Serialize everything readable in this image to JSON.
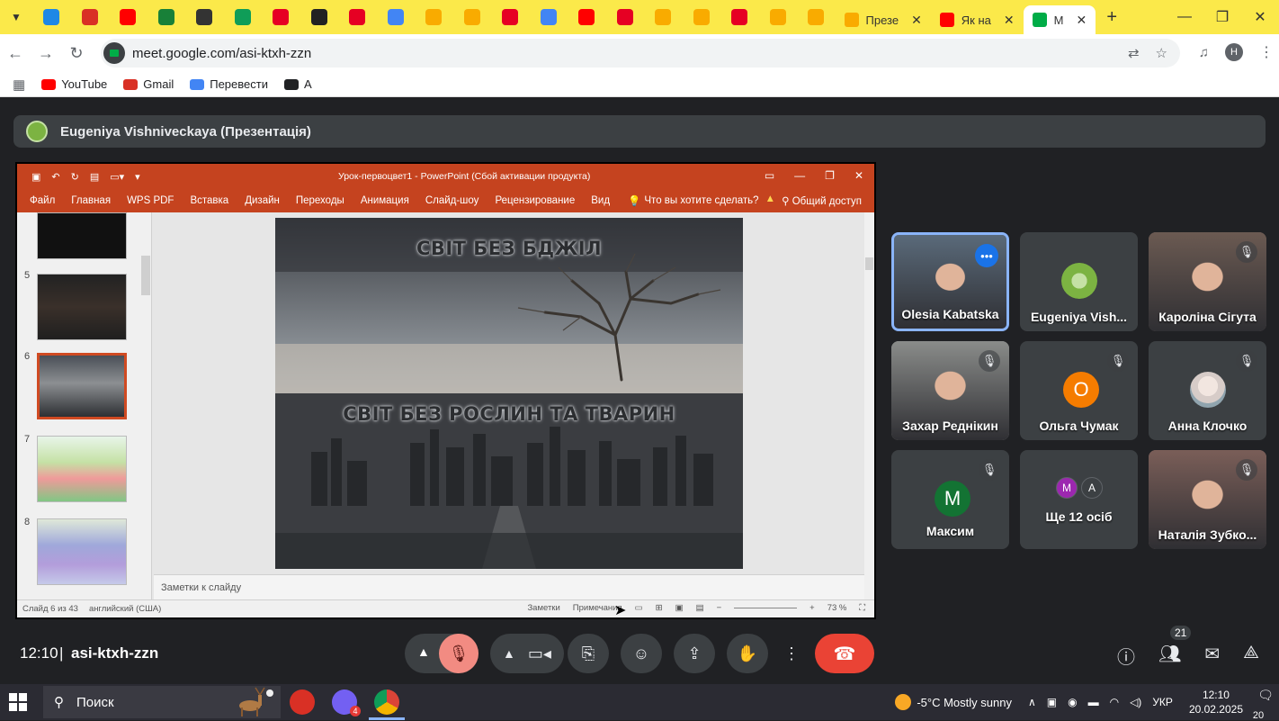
{
  "browser": {
    "pinned_tabs": [
      {
        "icon": "edge-icon",
        "color": "#1e88e5"
      },
      {
        "icon": "gmail-icon",
        "color": "#d93025"
      },
      {
        "icon": "youtube-icon",
        "color": "#ff0000"
      },
      {
        "icon": "classroom-icon",
        "color": "#188038"
      },
      {
        "icon": "yandex-icon",
        "color": "#333333"
      },
      {
        "icon": "add-icon",
        "color": "#0f9d58"
      },
      {
        "icon": "pinterest-icon",
        "color": "#e60023"
      },
      {
        "icon": "tutor-icon",
        "color": "#222222"
      },
      {
        "icon": "pinterest-icon",
        "color": "#e60023"
      },
      {
        "icon": "google-icon",
        "color": "#4285f4"
      },
      {
        "icon": "generic-icon",
        "color": "#f9ab00"
      },
      {
        "icon": "generic-icon",
        "color": "#f9ab00"
      },
      {
        "icon": "pinterest-icon",
        "color": "#e60023"
      },
      {
        "icon": "google-icon",
        "color": "#4285f4"
      },
      {
        "icon": "youtube-icon",
        "color": "#ff0000"
      },
      {
        "icon": "pinterest-icon",
        "color": "#e60023"
      },
      {
        "icon": "generic-icon",
        "color": "#f9ab00"
      },
      {
        "icon": "generic-icon",
        "color": "#f9ab00"
      },
      {
        "icon": "pinterest-icon",
        "color": "#e60023"
      },
      {
        "icon": "generic-icon",
        "color": "#f9ab00"
      },
      {
        "icon": "generic-icon",
        "color": "#f9ab00"
      }
    ],
    "tabs": [
      {
        "label": "Презе",
        "active": false,
        "color": "#f9ab00"
      },
      {
        "label": "Як на",
        "active": false,
        "color": "#ff0000"
      },
      {
        "label": "М",
        "active": true,
        "color": "#00ac47"
      }
    ],
    "url": "meet.google.com/asi-ktxh-zzn",
    "profile_letter": "H",
    "bookmarks": [
      {
        "label": "YouTube",
        "icon": "youtube-icon",
        "color": "#ff0000"
      },
      {
        "label": "Gmail",
        "icon": "gmail-icon",
        "color": "#d93025"
      },
      {
        "label": "Перевести",
        "icon": "translate-icon",
        "color": "#4285f4"
      },
      {
        "label": "A",
        "icon": "globe-icon",
        "color": "#202124"
      }
    ]
  },
  "meet": {
    "presenter_name": "Eugeniya Vishniveckaya (Презентація)",
    "time": "12:10",
    "separator": "|",
    "meeting_code": "asi-ktxh-zzn",
    "participants_count": "21",
    "participants": [
      {
        "name": "Olesia Kabatska",
        "type": "video",
        "speaking": true,
        "muted": false,
        "bg": "#5a6a7a"
      },
      {
        "name": "Eugeniya Vish...",
        "type": "logo",
        "muted": false,
        "bg": "#3c4043"
      },
      {
        "name": "Кароліна Сігута",
        "type": "video",
        "muted": true,
        "bg": "#6b5a52"
      },
      {
        "name": "Захар Реднікин",
        "type": "video",
        "muted": true,
        "bg": "#8a8c8a"
      },
      {
        "name": "Ольга Чумак",
        "type": "letter",
        "letter": "О",
        "letter_color": "#f57c00",
        "muted": true,
        "bg": "#3c4043"
      },
      {
        "name": "Анна Клочко",
        "type": "avatar",
        "muted": true,
        "bg": "#3c4043"
      },
      {
        "name": "Максим",
        "type": "letter",
        "letter": "M",
        "letter_color": "#137333",
        "muted": true,
        "bg": "#3c4043"
      },
      {
        "name": "Ще 12 осіб",
        "type": "group",
        "letters": [
          "M",
          "A"
        ],
        "muted": false,
        "bg": "#3c4043"
      },
      {
        "name": "Наталія Зубко...",
        "type": "video",
        "muted": true,
        "bg": "#7a5e58"
      }
    ]
  },
  "ppt": {
    "window_title": "Урок-первоцвет1 - PowerPoint (Сбой активации продукта)",
    "ribbon_tabs": [
      "Файл",
      "Главная",
      "WPS PDF",
      "Вставка",
      "Дизайн",
      "Переходы",
      "Анимация",
      "Слайд-шоу",
      "Рецензирование",
      "Вид"
    ],
    "tell_me": "Что вы хотите сделать?",
    "share": "Общий доступ",
    "thumb_numbers": [
      "5",
      "6",
      "7",
      "8"
    ],
    "slide_line1": "СВІТ БЕЗ БДЖІЛ",
    "slide_line2": "СВІТ БЕЗ РОСЛИН ТА ТВАРИН",
    "notes_placeholder": "Заметки к слайду",
    "status_slide": "Слайд 6 из 43",
    "status_lang": "английский (США)",
    "status_notes": "Заметки",
    "status_comments": "Примечания",
    "zoom": "73 %"
  },
  "taskbar": {
    "search_label": "Поиск",
    "weather": "-5°C  Mostly sunny",
    "language": "УКР",
    "clock_time": "12:10",
    "clock_date": "20.02.2025",
    "notifications": "20",
    "viber_badge": "4"
  }
}
